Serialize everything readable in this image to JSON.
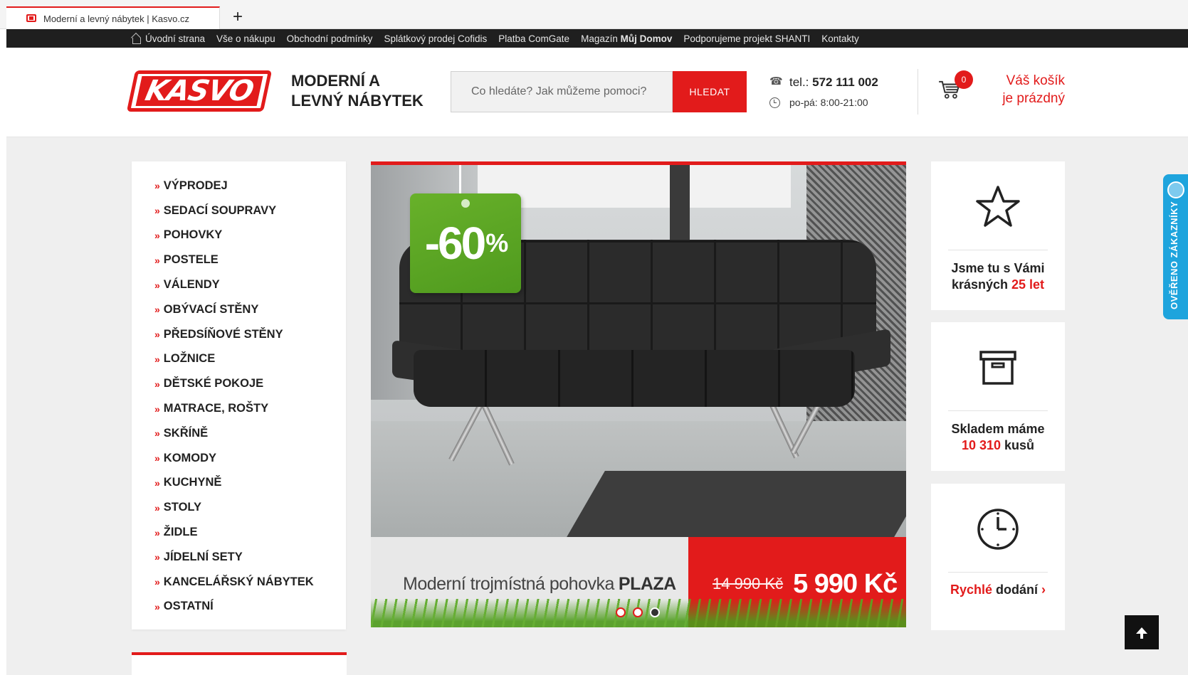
{
  "browser": {
    "tab_title": "Moderní a levný nábytek | Kasvo.cz",
    "new_tab": "+"
  },
  "topnav": {
    "items": [
      "Úvodní strana",
      "Vše o nákupu",
      "Obchodní podmínky",
      "Splátkový prodej Cofidis",
      "Platba ComGate"
    ],
    "magazin_prefix": "Magazín",
    "magazin_bold": "Můj Domov",
    "items2": [
      "Podporujeme projekt SHANTI",
      "Kontakty"
    ]
  },
  "header": {
    "logo": "KASVO",
    "tagline_line1": "MODERNÍ A",
    "tagline_line2": "LEVNÝ NÁBYTEK",
    "search_placeholder": "Co hledáte? Jak můžeme pomoci?",
    "search_button": "HLEDAT",
    "phone_prefix": "tel.:",
    "phone_number": "572 111 002",
    "hours": "po-pá: 8:00-21:00",
    "cart_count": "0",
    "cart_line1": "Váš košík",
    "cart_line2": "je prázdný"
  },
  "categories": {
    "items": [
      "VÝPRODEJ",
      "SEDACÍ SOUPRAVY",
      "POHOVKY",
      "POSTELE",
      "VÁLENDY",
      "OBÝVACÍ STĚNY",
      "PŘEDSÍŇOVÉ STĚNY",
      "LOŽNICE",
      "DĚTSKÉ POKOJE",
      "MATRACE, ROŠTY",
      "SKŘÍNĚ",
      "KOMODY",
      "KUCHYNĚ",
      "STOLY",
      "ŽIDLE",
      "JÍDELNÍ SETY",
      "KANCELÁŘSKÝ NÁBYTEK",
      "OSTATNÍ"
    ],
    "chevron": "»"
  },
  "hero": {
    "discount": "-60",
    "percent": "%",
    "caption_text": "Moderní trojmístná pohovka",
    "caption_bold": "PLAZA",
    "old_price": "14 990 Kč",
    "new_price": "5 990 Kč",
    "active_dot": 2
  },
  "info": {
    "box1_line1": "Jsme tu s Vámi",
    "box1_line2_pre": "krásných",
    "box1_line2_hl": "25 let",
    "box2_line1": "Skladem máme",
    "box2_hl": "10 310",
    "box2_post": "kusů",
    "box3_hl": "Rychlé",
    "box3_text": "dodání",
    "box3_arrow": "›"
  },
  "verified_badge": "OVĚŘENO ZÁKAZNÍKY",
  "colors": {
    "accent": "#e21b1b",
    "topnav_bg": "#1f1f1f",
    "page_bg": "#efefef",
    "badge_blue": "#1ea4dd"
  }
}
